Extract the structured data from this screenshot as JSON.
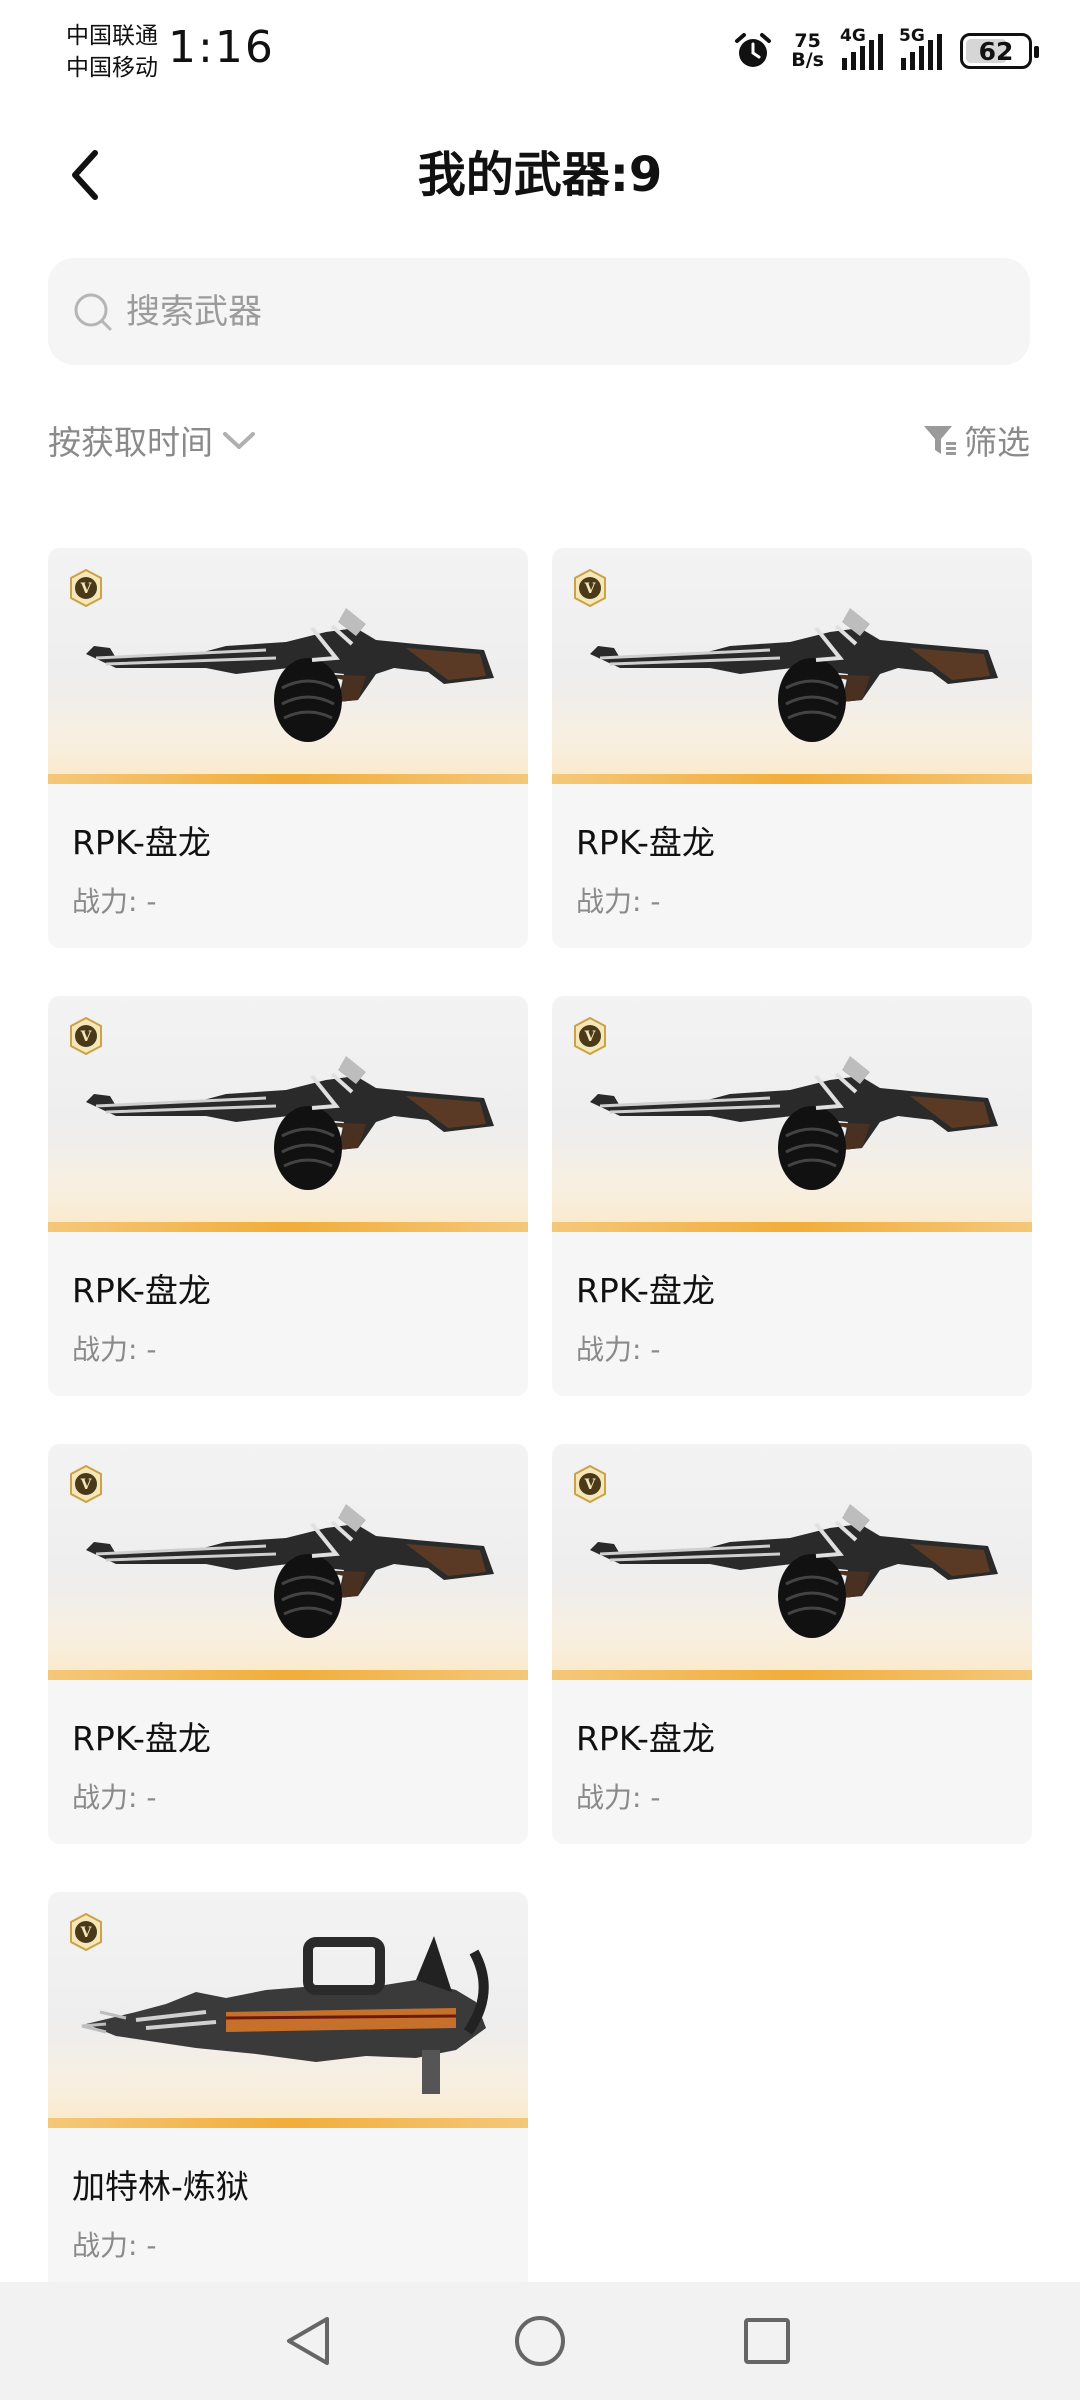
{
  "status_bar": {
    "carrier_1": "中国联通",
    "carrier_2": "中国移动",
    "time": "1:16",
    "speed_value": "75",
    "speed_unit": "B/s",
    "net_1": "4G",
    "net_2": "5G",
    "battery": "62"
  },
  "header": {
    "title": "我的武器:9",
    "back_icon": "chevron-left-icon"
  },
  "search": {
    "placeholder": "搜索武器",
    "value": ""
  },
  "toolbar": {
    "sort_label": "按获取时间",
    "filter_label": "筛选"
  },
  "weapons": [
    {
      "name": "RPK-盘龙",
      "power": "战力: -",
      "badge": "V"
    },
    {
      "name": "RPK-盘龙",
      "power": "战力: -",
      "badge": "V"
    },
    {
      "name": "RPK-盘龙",
      "power": "战力: -",
      "badge": "V"
    },
    {
      "name": "RPK-盘龙",
      "power": "战力: -",
      "badge": "V"
    },
    {
      "name": "RPK-盘龙",
      "power": "战力: -",
      "badge": "V"
    },
    {
      "name": "RPK-盘龙",
      "power": "战力: -",
      "badge": "V"
    },
    {
      "name": "加特林-炼狱",
      "power": "战力: -",
      "badge": "V"
    }
  ],
  "nav_bar": [
    "back-triangle-icon",
    "home-circle-icon",
    "recents-square-icon"
  ],
  "colors": {
    "accent_bar": "#f2ad3a",
    "text_secondary": "#8a8a8a",
    "card_bg": "#f6f6f6"
  }
}
